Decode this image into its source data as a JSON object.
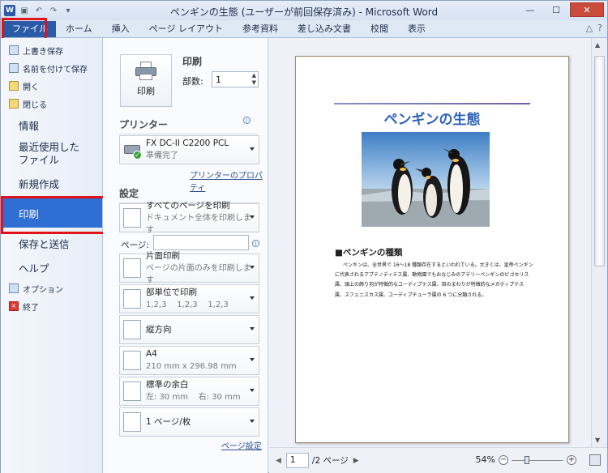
{
  "window": {
    "title": "ペンギンの生態 (ユーザーが前回保存済み) - Microsoft Word",
    "logo": "W",
    "controls": {
      "minimize": "—",
      "maximize": "☐",
      "close": "✕"
    }
  },
  "ribbon": {
    "tabs": [
      "ファイル",
      "ホーム",
      "挿入",
      "ページ レイアウト",
      "参考資料",
      "差し込み文書",
      "校閲",
      "表示"
    ],
    "help_icons": [
      "△",
      "?"
    ]
  },
  "nav": {
    "small_top": [
      {
        "label": "上書き保存",
        "icon": "save-icon"
      },
      {
        "label": "名前を付けて保存",
        "icon": "save-as-icon"
      },
      {
        "label": "開く",
        "icon": "open-folder-icon"
      },
      {
        "label": "閉じる",
        "icon": "close-folder-icon"
      }
    ],
    "info": "情報",
    "recent_line1": "最近使用した",
    "recent_line2": "ファイル",
    "new": "新規作成",
    "print": "印刷",
    "save_send": "保存と送信",
    "help": "ヘルプ",
    "options": "オプション",
    "exit": "終了"
  },
  "print": {
    "button_label": "印刷",
    "title": "印刷",
    "copies_label": "部数:",
    "copies_value": "1",
    "printer_section": "プリンター",
    "printer_name": "FX DC-II C2200 PCL",
    "printer_status": "準備完了",
    "printer_props": "プリンターのプロパティ",
    "settings_section": "設定",
    "pages_label": "ページ:",
    "page_setup": "ページ設定",
    "settings": [
      {
        "main": "すべてのページを印刷",
        "sub": "ドキュメント全体を印刷します"
      },
      {
        "main": "片面印刷",
        "sub": "ページの片面のみを印刷します"
      },
      {
        "main": "部単位で印刷",
        "sub": "1,2,3    1,2,3    1,2,3"
      },
      {
        "main": "縦方向",
        "sub": ""
      },
      {
        "main": "A4",
        "sub": "210 mm x 296.98 mm"
      },
      {
        "main": "標準の余白",
        "sub": "左: 30 mm    右: 30 mm"
      },
      {
        "main": "1 ページ/枚",
        "sub": ""
      }
    ]
  },
  "document": {
    "title": "ペンギンの生態",
    "heading": "■ペンギンの種類",
    "body": "ペンギンは、全世界で 16～18 種類存在するといわれている。大きくは、皇帝ペンギンに代表されるアプテノディテス属、動物園でもおなじみのアデリーペンギンのピゴセリス属、頭上の飾り羽が特徴的なユーディプテス属、目のまわりが特徴的なメガディプテス属、スフェニスカス属、ユーディプチューラ属の 6 つに分類される。"
  },
  "status": {
    "page_current": "1",
    "page_total": "/2 ページ",
    "zoom": "54%",
    "zoom_level": 0.54
  }
}
